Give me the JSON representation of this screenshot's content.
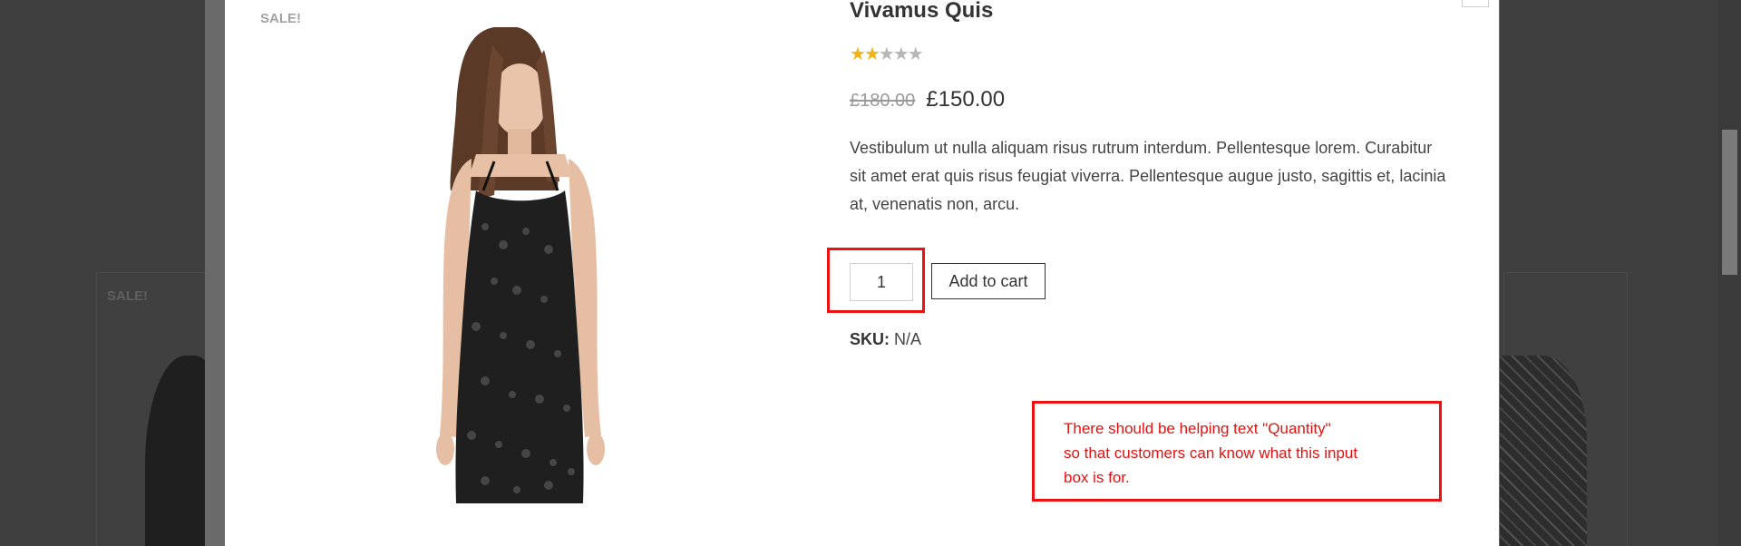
{
  "background": {
    "sale_label": "SALE!"
  },
  "product": {
    "sale_label": "SALE!",
    "title": "Vivamus Quis",
    "rating": {
      "value": 2,
      "max": 5
    },
    "old_price": "£180.00",
    "new_price": "£150.00",
    "description": "Vestibulum ut nulla aliquam risus rutrum interdum. Pellentesque lorem. Curabitur sit amet erat quis risus feugiat viverra. Pellentesque augue justo, sagittis et, lacinia at, venenatis non, arcu.",
    "quantity_value": "1",
    "add_to_cart_label": "Add to cart",
    "sku_label": "SKU:",
    "sku_value": "N/A"
  },
  "annotation": {
    "lines": [
      "There should be helping text \"Quantity\"",
      "so that customers can know what this input",
      "box is for."
    ]
  },
  "colors": {
    "accent_star": "#f0b315",
    "annotation_red": "#ee1111",
    "overlay": "#3f3f3f"
  }
}
